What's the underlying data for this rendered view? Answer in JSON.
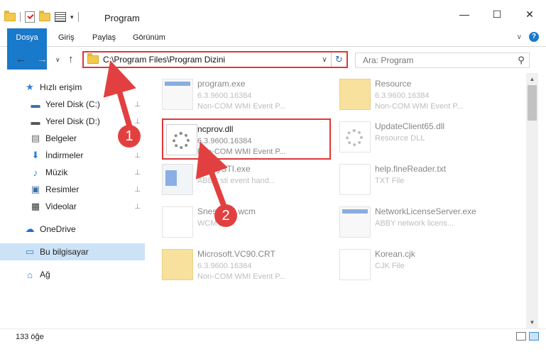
{
  "window": {
    "title": "Program",
    "controls": {
      "minimize": "—",
      "maximize": "☐",
      "close": "✕"
    }
  },
  "ribbon": {
    "tabs": [
      "Dosya",
      "Giriş",
      "Paylaş",
      "Görünüm"
    ],
    "expand_glyph": "∨",
    "help_glyph": "?"
  },
  "navigation": {
    "back_glyph": "←",
    "forward_glyph": "→",
    "recent_glyph": "∨",
    "up_glyph": "↑",
    "address": "C:\\Program Files\\Program Dizini",
    "dropdown_glyph": "∨",
    "refresh_glyph": "↻",
    "search_placeholder": "Ara: Program",
    "search_glyph": "⚲"
  },
  "sidebar": {
    "items": [
      {
        "label": "Hızlı erişim",
        "icon": "star-icon",
        "glyph": "★",
        "color": "#2f7fd4",
        "pinned": false
      },
      {
        "label": "Yerel Disk (C:)",
        "icon": "drive-icon",
        "glyph": "▬",
        "color": "#3b6fa8",
        "pinned": true
      },
      {
        "label": "Yerel Disk (D:)",
        "icon": "drive-icon",
        "glyph": "▬",
        "color": "#555555",
        "pinned": true
      },
      {
        "label": "Belgeler",
        "icon": "documents-icon",
        "glyph": "▤",
        "color": "#6a6a6a",
        "pinned": true
      },
      {
        "label": "İndirmeler",
        "icon": "download-icon",
        "glyph": "⬇",
        "color": "#2f7fd4",
        "pinned": true
      },
      {
        "label": "Müzik",
        "icon": "music-icon",
        "glyph": "♪",
        "color": "#2f7fd4",
        "pinned": true
      },
      {
        "label": "Resimler",
        "icon": "pictures-icon",
        "glyph": "▣",
        "color": "#3b6fa8",
        "pinned": true
      },
      {
        "label": "Videolar",
        "icon": "videos-icon",
        "glyph": "▦",
        "color": "#333333",
        "pinned": true
      },
      {
        "label": "OneDrive",
        "icon": "cloud-icon",
        "glyph": "☁",
        "color": "#1e6fc9",
        "pinned": false
      },
      {
        "label": "Bu bilgisayar",
        "icon": "computer-icon",
        "glyph": "▭",
        "color": "#2f7fd4",
        "pinned": false
      },
      {
        "label": "Ağ",
        "icon": "network-icon",
        "glyph": "⌂",
        "color": "#2f7fd4",
        "pinned": false
      }
    ],
    "pin_glyph": "📌"
  },
  "files": [
    {
      "name": "program.exe",
      "line2": "6.3.9600.16384",
      "line3": "Non-COM WMI Event P...",
      "kind": "exe",
      "faded": true,
      "highlight": false
    },
    {
      "name": "Resource",
      "line2": "6.3.9600.16384",
      "line3": "Non-COM WMI Event P...",
      "kind": "folder",
      "faded": true,
      "highlight": false
    },
    {
      "name": "ncprov.dll",
      "line2": "6.3.9600.16384",
      "line3": "Non-COM WMI Event P...",
      "kind": "dll",
      "faded": false,
      "highlight": true
    },
    {
      "name": "UpdateClient65.dll",
      "line2": "Resource DLL",
      "line3": "",
      "kind": "dll",
      "faded": true,
      "highlight": false
    },
    {
      "name": "AbbyySTI.exe",
      "line2": "ABBY sti event hand...",
      "line3": "",
      "kind": "win",
      "faded": true,
      "highlight": false
    },
    {
      "name": "help.fineReader.txt",
      "line2": "TXT File",
      "line3": "",
      "kind": "doc",
      "faded": true,
      "highlight": false
    },
    {
      "name": "Snes0032.wcm",
      "line2": "WCM File",
      "line3": "",
      "kind": "doc",
      "faded": true,
      "highlight": false
    },
    {
      "name": "NetworkLicenseServer.exe",
      "line2": "ABBY network licens...",
      "line3": "",
      "kind": "exe",
      "faded": true,
      "highlight": false
    },
    {
      "name": "Microsoft.VC90.CRT",
      "line2": "6.3.9600.16384",
      "line3": "Non-COM WMI Event P...",
      "kind": "folder",
      "faded": true,
      "highlight": false
    },
    {
      "name": "Korean.cjk",
      "line2": "CJK File",
      "line3": "",
      "kind": "doc",
      "faded": true,
      "highlight": false
    }
  ],
  "status": {
    "item_count": "133 öğe"
  },
  "annotations": {
    "step1": "1",
    "step2": "2",
    "accent_color": "#e24040"
  }
}
